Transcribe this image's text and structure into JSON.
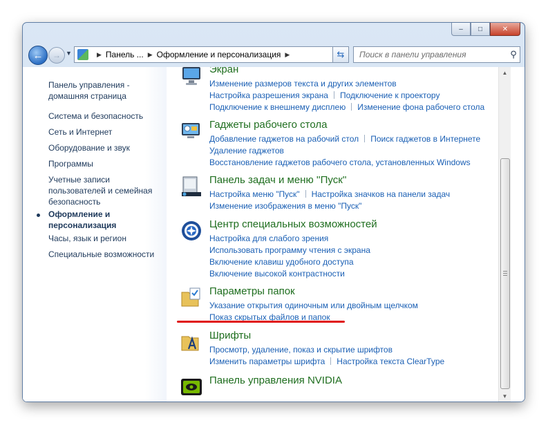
{
  "window": {
    "caption_buttons": [
      "–",
      "□",
      "✕"
    ]
  },
  "toolbar": {
    "back_icon": "arrow-left-icon",
    "address": {
      "segments": [
        "Панель ...",
        "Оформление и персонализация"
      ]
    },
    "search": {
      "placeholder": "Поиск в панели управления"
    }
  },
  "sidebar": {
    "home_link": [
      "Панель управления -",
      "домашняя страница"
    ],
    "items": [
      {
        "label": "Система и безопасность"
      },
      {
        "label": "Сеть и Интернет"
      },
      {
        "label": "Оборудование и звук"
      },
      {
        "label": "Программы"
      },
      {
        "label": [
          "Учетные записи",
          "пользователей и семейная",
          "безопасность"
        ]
      },
      {
        "label": [
          "Оформление и",
          "персонализация"
        ],
        "current": true
      },
      {
        "label": "Часы, язык и регион"
      },
      {
        "label": "Специальные возможности"
      }
    ]
  },
  "categories": [
    {
      "title": "Экран",
      "icon": "monitor-icon",
      "links": [
        [
          "Изменение размеров текста и других элементов"
        ],
        [
          "Настройка разрешения экрана",
          "Подключение к проектору"
        ],
        [
          "Подключение к внешнему дисплею",
          "Изменение фона рабочего стола"
        ]
      ]
    },
    {
      "title": "Гаджеты рабочего стола",
      "icon": "gadgets-icon",
      "links": [
        [
          "Добавление гаджетов на рабочий стол",
          "Поиск гаджетов в Интернете"
        ],
        [
          "Удаление гаджетов"
        ],
        [
          "Восстановление гаджетов рабочего стола, установленных Windows"
        ]
      ]
    },
    {
      "title": "Панель задач и меню ''Пуск''",
      "icon": "taskbar-icon",
      "links": [
        [
          "Настройка меню \"Пуск\"",
          "Настройка значков на панели задач"
        ],
        [
          "Изменение изображения в меню \"Пуск\""
        ]
      ]
    },
    {
      "title": "Центр специальных возможностей",
      "icon": "ease-of-access-icon",
      "links": [
        [
          "Настройка для слабого зрения"
        ],
        [
          "Использовать программу чтения с экрана"
        ],
        [
          "Включение клавиш удобного доступа"
        ],
        [
          "Включение высокой контрастности"
        ]
      ]
    },
    {
      "title": "Параметры папок",
      "icon": "folder-options-icon",
      "links": [
        [
          "Указание открытия одиночным или двойным щелчком"
        ],
        [
          "Показ скрытых файлов и папок"
        ]
      ]
    },
    {
      "title": "Шрифты",
      "icon": "fonts-icon",
      "links": [
        [
          "Просмотр, удаление, показ и скрытие шрифтов"
        ],
        [
          "Изменить параметры шрифта",
          "Настройка текста ClearType"
        ]
      ]
    },
    {
      "title": "Панель управления NVIDIA",
      "icon": "nvidia-icon",
      "links": []
    }
  ],
  "colors": {
    "link": "#1a5fb4",
    "category_title": "#1f6e1f",
    "highlight_underline": "#e01010"
  }
}
